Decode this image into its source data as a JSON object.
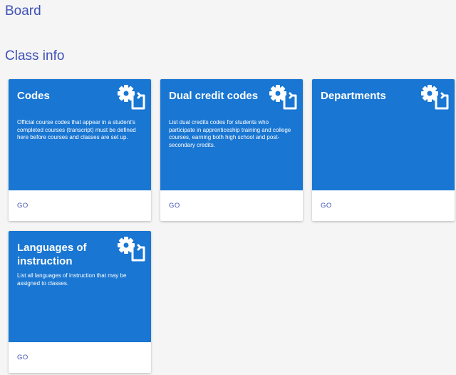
{
  "page": {
    "board_title": "Board",
    "section_title": "Class info"
  },
  "cards": [
    {
      "title": "Codes",
      "description": "Official course codes that appear in a student's completed courses (transcript) must be defined here before courses and classes are set up.",
      "action_label": "GO",
      "icon": "settings-applications-icon"
    },
    {
      "title": "Dual credit codes",
      "description": "List dual credits codes for students who participate in apprenticeship training and college courses, earning both high school and post-secondary credits.",
      "action_label": "GO",
      "icon": "settings-applications-icon"
    },
    {
      "title": "Departments",
      "description": "",
      "action_label": "GO",
      "icon": "settings-applications-icon"
    },
    {
      "title": "Languages of instruction",
      "description": "List all languages of instruction that may be assigned to classes.",
      "action_label": "GO",
      "icon": "settings-applications-icon"
    }
  ],
  "colors": {
    "card_header": "#1976d2",
    "heading_text": "#3f51b5",
    "background": "#f5f5f5"
  }
}
